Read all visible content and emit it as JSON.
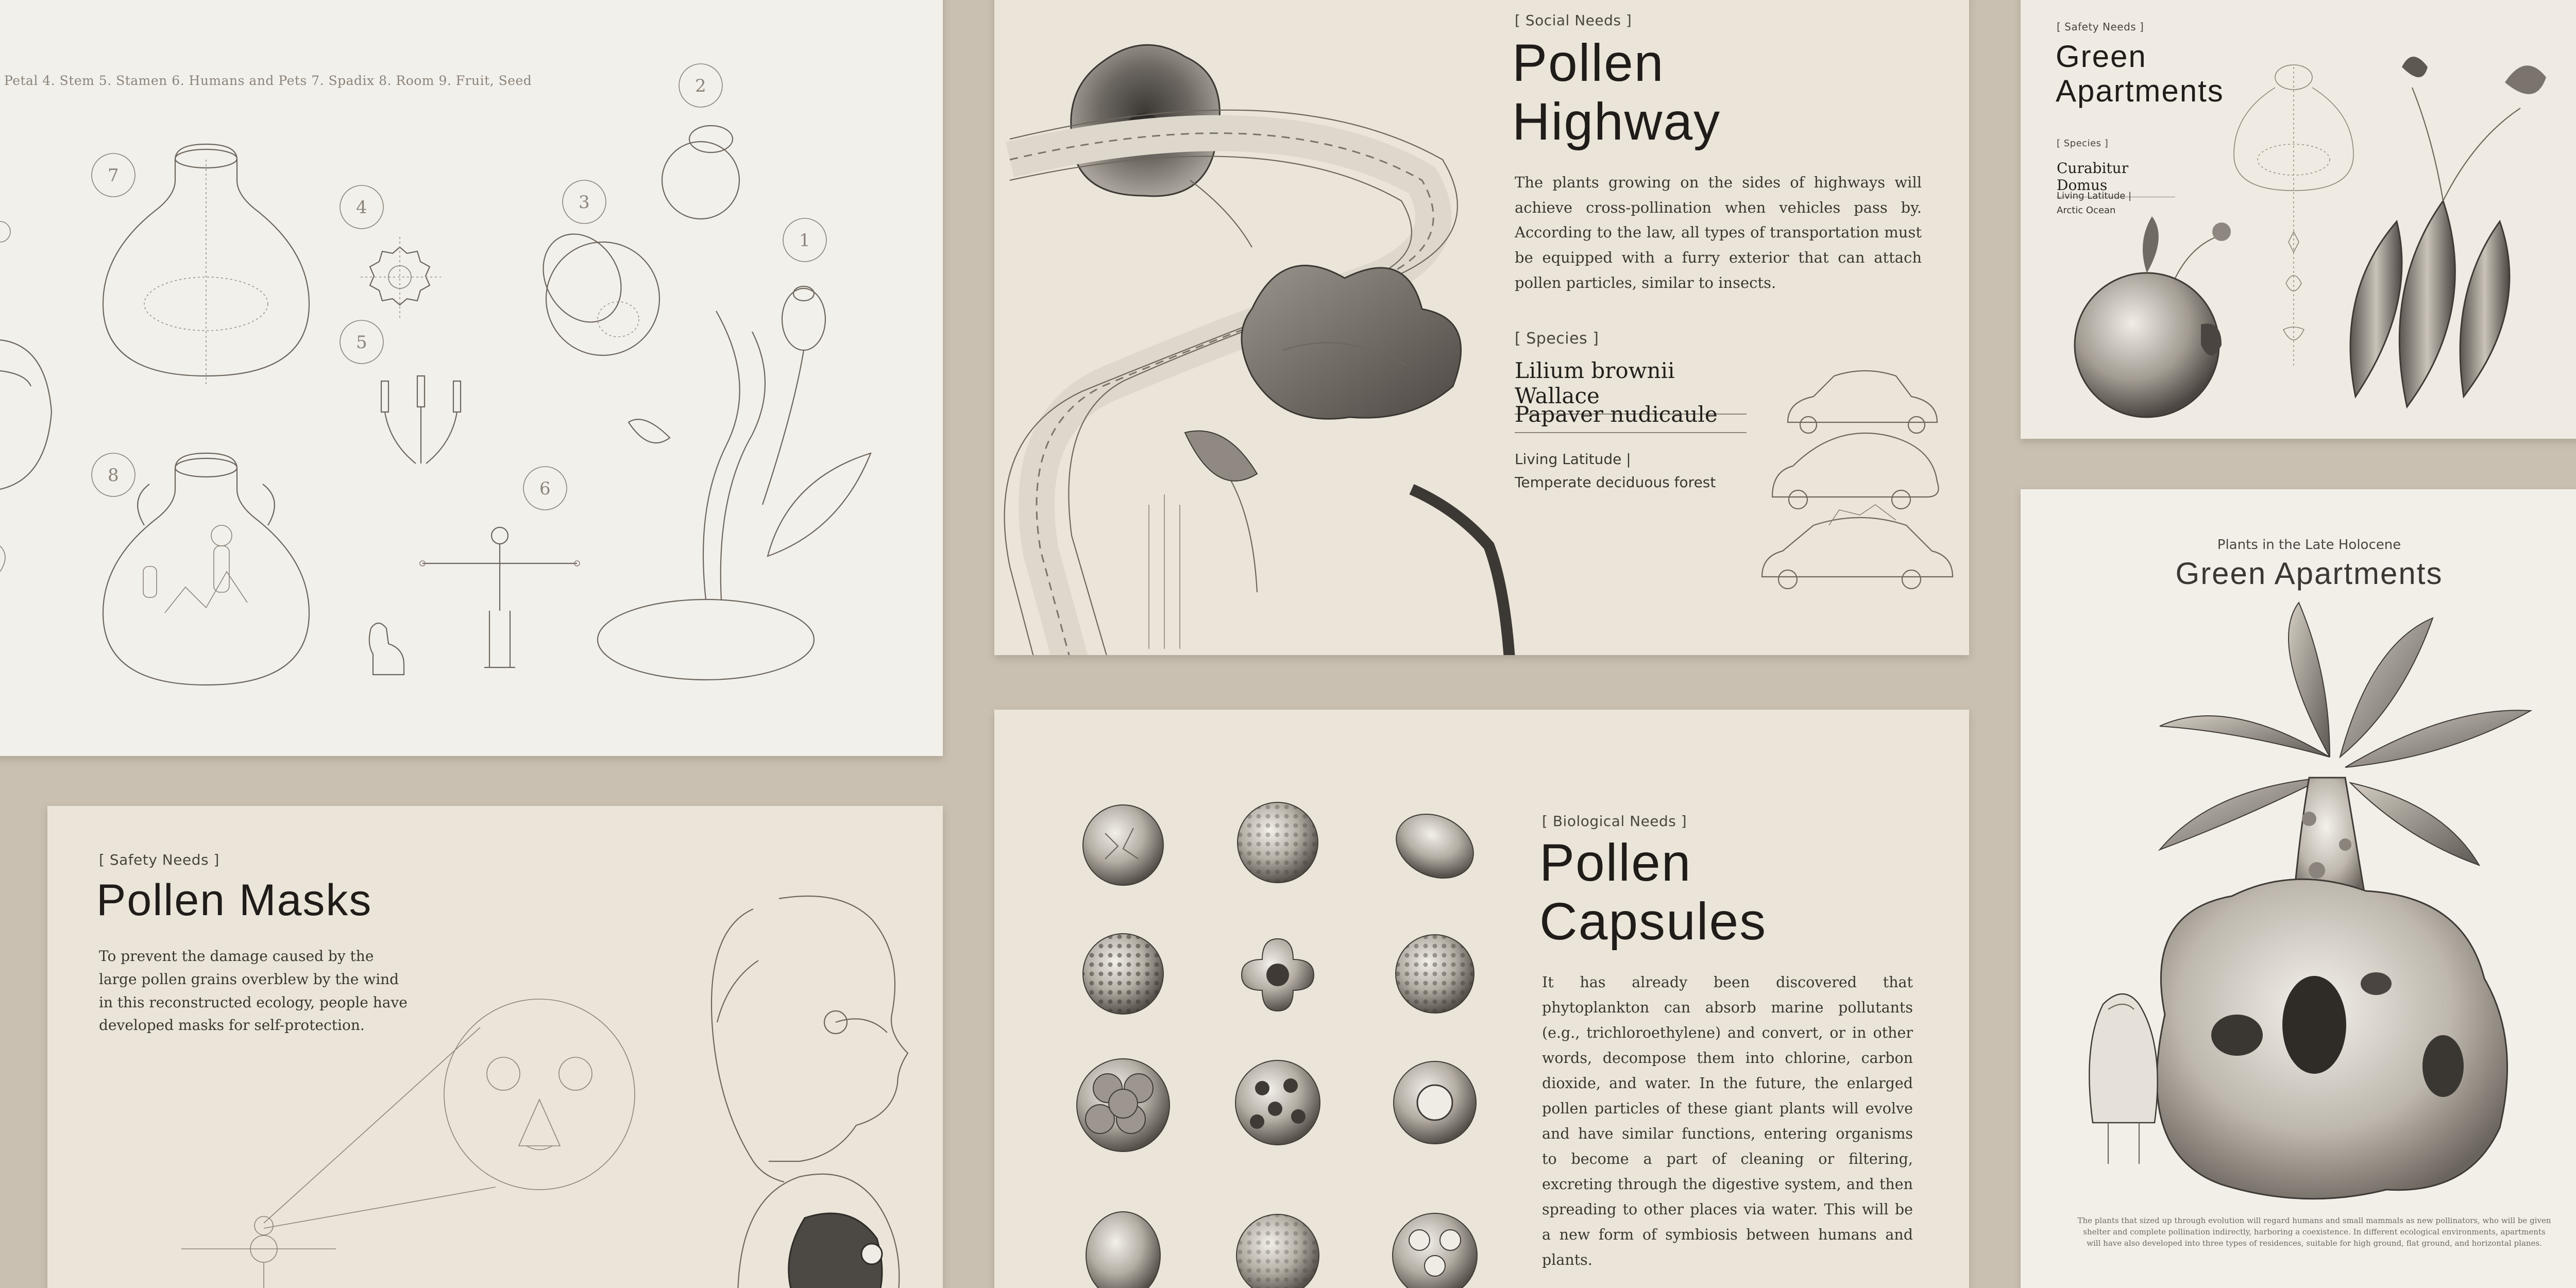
{
  "diagram_card": {
    "caption": "Petal 4. Stem 5. Stamen 6. Humans and Pets 7. Spadix 8. Room 9. Fruit, Seed",
    "numbers": [
      "1",
      "2",
      "3",
      "4",
      "5",
      "6",
      "7",
      "8"
    ]
  },
  "pollen_highway": {
    "tag": "[ Social Needs ]",
    "title_line1": "Pollen",
    "title_line2": "Highway",
    "body": "The plants growing on the sides of highways will achieve cross-pollination when vehicles pass by. According to the law, all types of transportation must be equipped with a furry exterior that can attach pollen particles, similar to insects.",
    "species_tag": "[ Species ]",
    "species": [
      "Lilium brownii Wallace",
      "Papaver nudicaule"
    ],
    "latitude_label": "Living Latitude |",
    "latitude_value": "Temperate deciduous forest"
  },
  "green_apartments_small": {
    "tag": "[ Safety Needs ]",
    "title_line1": "Green",
    "title_line2": "Apartments",
    "species_tag": "[ Species ]",
    "species": "Curabitur Domus",
    "latitude_label": "Living Latitude |",
    "latitude_value": "Arctic Ocean"
  },
  "pollen_masks": {
    "tag": "[ Safety Needs ]",
    "title": "Pollen Masks",
    "body": "To prevent the damage caused by the large pollen grains overblew by the wind in this reconstructed ecology, people have developed masks for self-protection."
  },
  "pollen_capsules": {
    "tag": "[ Biological Needs ]",
    "title_line1": "Pollen",
    "title_line2": "Capsules",
    "body": "It has already been discovered that phytoplankton can absorb marine pollutants (e.g., trichloroethylene) and convert, or in other words, decompose them into chlorine, carbon dioxide, and water. In the future, the enlarged pollen particles of these giant plants will evolve and have similar functions, entering organisms to become a part of cleaning or filtering, excreting through the digestive system, and then spreading to other places via water. This will be a new form of symbiosis between humans and plants."
  },
  "green_apartments_poster": {
    "kicker": "Plants in the Late Holocene",
    "title": "Green Apartments",
    "footnote": "The plants that sized up through evolution will regard humans and small mammals as new pollinators, who will be given shelter and complete pollination indirectly, harboring a coexistence. In different ecological environments, apartments will have also developed into three types of residences, suitable for high ground, flat ground, and horizontal planes."
  }
}
